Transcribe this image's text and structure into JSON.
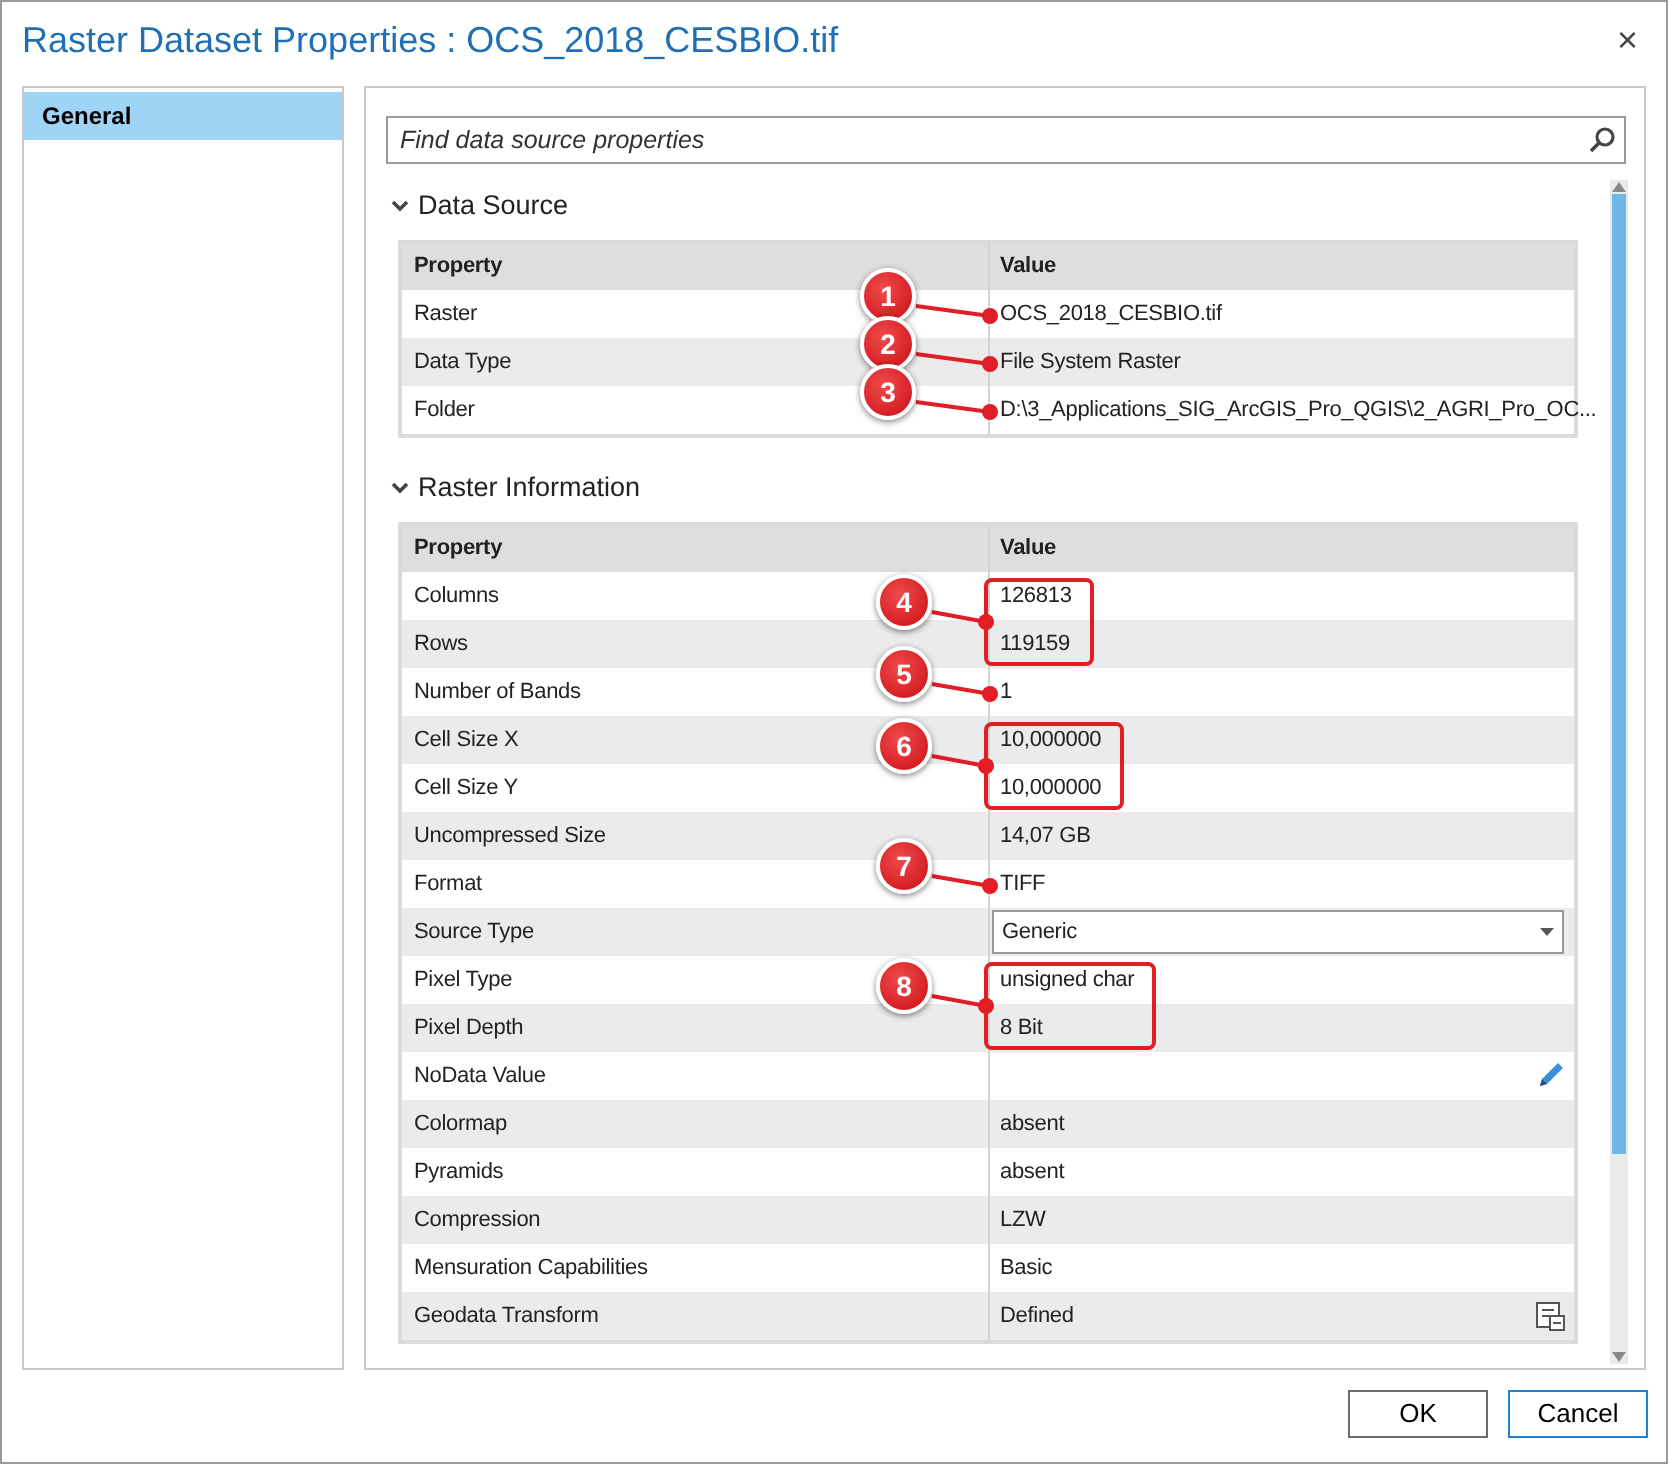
{
  "window": {
    "title": "Raster Dataset Properties : OCS_2018_CESBIO.tif",
    "close": "×"
  },
  "sidebar": {
    "items": [
      {
        "label": "General",
        "selected": true
      }
    ]
  },
  "search": {
    "placeholder": "Find data source properties"
  },
  "sections": [
    {
      "title": "Data Source",
      "expanded": true,
      "columns": [
        "Property",
        "Value"
      ],
      "rows": [
        {
          "kind": "text",
          "property": "Raster",
          "value": "OCS_2018_CESBIO.tif",
          "callout": "1"
        },
        {
          "kind": "text",
          "property": "Data Type",
          "value": "File System Raster",
          "callout": "2"
        },
        {
          "kind": "text",
          "property": "Folder",
          "value": "D:\\3_Applications_SIG_ArcGIS_Pro_QGIS\\2_AGRI_Pro_OC...",
          "callout": "3"
        }
      ]
    },
    {
      "title": "Raster Information",
      "expanded": true,
      "columns": [
        "Property",
        "Value"
      ],
      "rows": [
        {
          "kind": "text",
          "property": "Columns",
          "value": "126813",
          "callout": "4",
          "boxed": true
        },
        {
          "kind": "text",
          "property": "Rows",
          "value": "119159",
          "boxed": true
        },
        {
          "kind": "text",
          "property": "Number of Bands",
          "value": "1",
          "callout": "5"
        },
        {
          "kind": "text",
          "property": "Cell Size X",
          "value": "10,000000",
          "callout": "6",
          "boxed": true
        },
        {
          "kind": "text",
          "property": "Cell Size Y",
          "value": "10,000000",
          "boxed": true
        },
        {
          "kind": "text",
          "property": "Uncompressed Size",
          "value": "14,07 GB"
        },
        {
          "kind": "text",
          "property": "Format",
          "value": "TIFF",
          "callout": "7"
        },
        {
          "kind": "dropdown",
          "property": "Source Type",
          "value": "Generic"
        },
        {
          "kind": "text",
          "property": "Pixel Type",
          "value": "unsigned char",
          "callout": "8",
          "boxed": true
        },
        {
          "kind": "text",
          "property": "Pixel Depth",
          "value": "8 Bit",
          "boxed": true
        },
        {
          "kind": "editable",
          "property": "NoData Value"
        },
        {
          "kind": "text",
          "property": "Colormap",
          "value": "absent"
        },
        {
          "kind": "text",
          "property": "Pyramids",
          "value": "absent"
        },
        {
          "kind": "text",
          "property": "Compression",
          "value": "LZW"
        },
        {
          "kind": "text",
          "property": "Mensuration Capabilities",
          "value": "Basic"
        },
        {
          "kind": "details",
          "property": "Geodata Transform",
          "value": "Defined"
        }
      ]
    }
  ],
  "buttons": [
    "OK",
    "Cancel"
  ]
}
